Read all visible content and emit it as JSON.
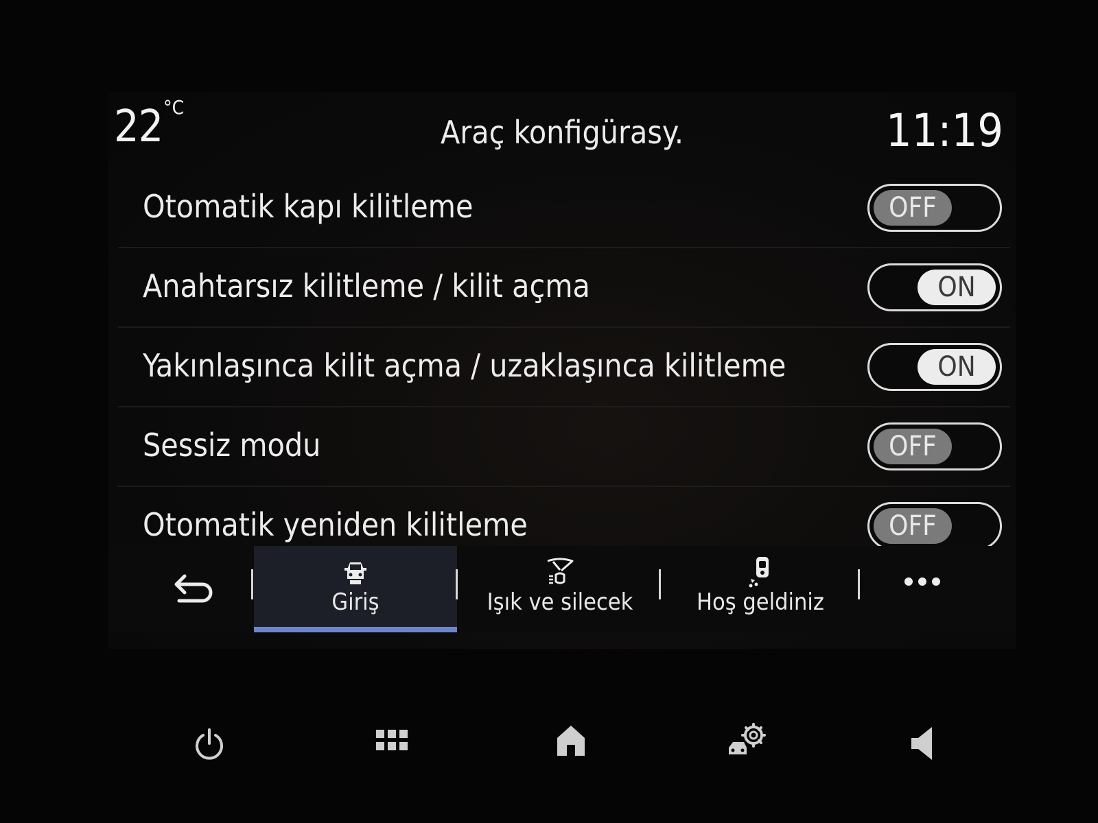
{
  "status": {
    "temperature": "22",
    "temperature_unit": "°C",
    "title": "Araç konfigürasy.",
    "clock": "11:19"
  },
  "settings": [
    {
      "label": "Otomatik kapı kilitleme",
      "state": "OFF"
    },
    {
      "label": "Anahtarsız kilitleme / kilit açma",
      "state": "ON"
    },
    {
      "label": "Yakınlaşınca kilit açma / uzaklaşınca kilitleme",
      "state": "ON"
    },
    {
      "label": "Sessiz modu",
      "state": "OFF"
    },
    {
      "label": "Otomatik yeniden kilitleme",
      "state": "OFF"
    }
  ],
  "tabs": {
    "back_icon": "back-arrow-icon",
    "items": [
      {
        "label": "Giriş",
        "icon": "car-lock-icon",
        "active": true
      },
      {
        "label": "Işık ve silecek",
        "icon": "light-wiper-icon",
        "active": false
      },
      {
        "label": "Hoş geldiniz",
        "icon": "welcome-icon",
        "active": false
      }
    ],
    "more_icon": "more-dots-icon"
  },
  "bottom_bar": {
    "icons": [
      "power-icon",
      "apps-grid-icon",
      "home-icon",
      "car-settings-icon",
      "volume-icon"
    ]
  },
  "colors": {
    "accent": "#6e86c9",
    "background": "#050505",
    "toggle_on_knob": "#ececec",
    "toggle_off_knob": "#7a7a7a"
  }
}
